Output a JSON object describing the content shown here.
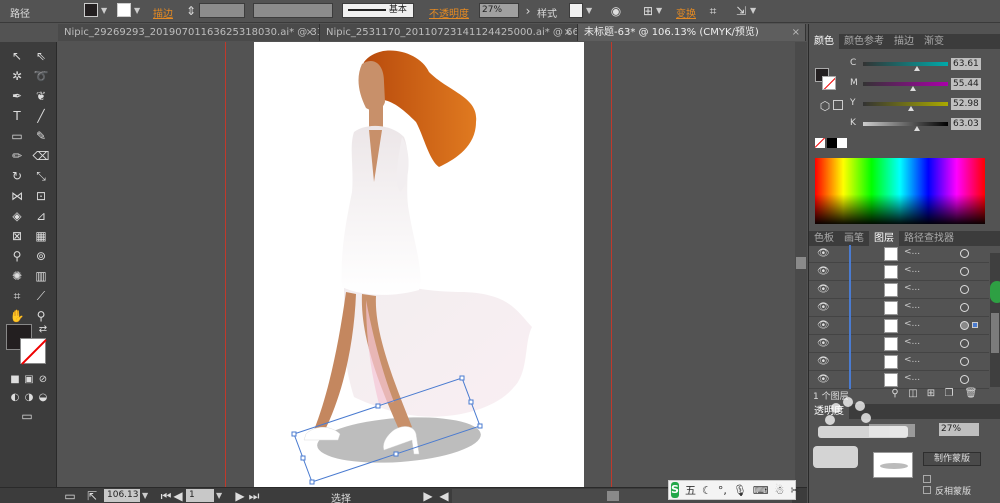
{
  "control_bar": {
    "object_type": "路径",
    "stroke_label": "描边",
    "stroke_style_label": "基本",
    "opacity_label": "不透明度",
    "opacity_value": "27%",
    "style_label": "样式",
    "transform_label": "变换"
  },
  "tabs": [
    {
      "label": "Nipic_29269293_20190701163625318030.ai* @ 33..."
    },
    {
      "label": "Nipic_2531170_20110723141124425000.ai* @ 66..."
    },
    {
      "label": "未标题-63* @ 106.13% (CMYK/预览)"
    }
  ],
  "status": {
    "zoom": "106.13",
    "page": "1",
    "tool": "选择"
  },
  "color_panel": {
    "tabs": [
      "颜色",
      "颜色参考",
      "描边",
      "渐变"
    ],
    "channels": [
      {
        "key": "C",
        "value": "63.61",
        "knob_pos": 0.6
      },
      {
        "key": "M",
        "value": "55.44",
        "knob_pos": 0.55
      },
      {
        "key": "Y",
        "value": "52.98",
        "knob_pos": 0.52
      },
      {
        "key": "K",
        "value": "63.03",
        "knob_pos": 0.6
      }
    ]
  },
  "layers_panel": {
    "tabs": [
      "色板",
      "画笔",
      "图层",
      "路径查找器"
    ],
    "rows": [
      {
        "name": "<...",
        "selected": false
      },
      {
        "name": "<...",
        "selected": false
      },
      {
        "name": "<...",
        "selected": false
      },
      {
        "name": "<...",
        "selected": false
      },
      {
        "name": "<...",
        "selected": true
      },
      {
        "name": "<...",
        "selected": false
      },
      {
        "name": "<...",
        "selected": false
      },
      {
        "name": "<...",
        "selected": false
      }
    ],
    "layer_count": "1 个图层"
  },
  "transparency_panel": {
    "title": "透明度",
    "opacity_value": "27%",
    "make_mask_label": "制作蒙版",
    "invert_mask_label": "反相蒙版"
  },
  "ime": {
    "logo": "S",
    "mode": "五"
  },
  "colors": {
    "hair": "#c85a10",
    "skin": "#c8906a",
    "dress_top": "#f0eaec",
    "shadow": "#b8b8b8"
  }
}
